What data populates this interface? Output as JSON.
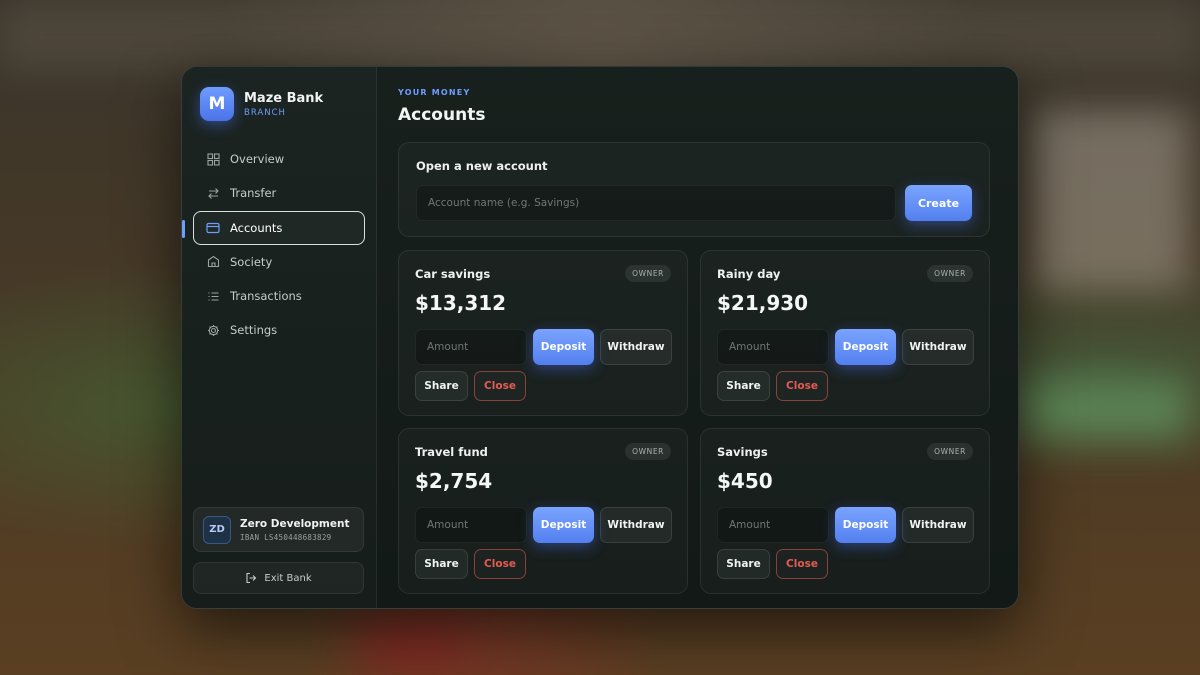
{
  "sidebar": {
    "brand": {
      "logo_letter": "M",
      "name": "Maze Bank",
      "subtitle": "BRANCH"
    },
    "nav": [
      {
        "label": "Overview",
        "icon": "grid-icon",
        "active": false
      },
      {
        "label": "Transfer",
        "icon": "transfer-arrows-icon",
        "active": false
      },
      {
        "label": "Accounts",
        "icon": "card-icon",
        "active": true
      },
      {
        "label": "Society",
        "icon": "bank-building-icon",
        "active": false
      },
      {
        "label": "Transactions",
        "icon": "list-icon",
        "active": false
      },
      {
        "label": "Settings",
        "icon": "gear-icon",
        "active": false
      }
    ],
    "profile": {
      "initials": "ZD",
      "name": "Zero Development",
      "iban": "IBAN LS450448683829"
    },
    "exit_label": "Exit Bank"
  },
  "main": {
    "eyebrow": "YOUR MONEY",
    "title": "Accounts",
    "open_account": {
      "title": "Open a new account",
      "input_placeholder": "Account name (e.g. Savings)",
      "input_value": "",
      "create_label": "Create"
    },
    "accounts": [
      {
        "name": "Car savings",
        "badge": "OWNER",
        "balance": "$13,312",
        "amount_placeholder": "Amount",
        "deposit": "Deposit",
        "withdraw": "Withdraw",
        "share": "Share",
        "close": "Close"
      },
      {
        "name": "Rainy day",
        "badge": "OWNER",
        "balance": "$21,930",
        "amount_placeholder": "Amount",
        "deposit": "Deposit",
        "withdraw": "Withdraw",
        "share": "Share",
        "close": "Close"
      },
      {
        "name": "Travel fund",
        "badge": "OWNER",
        "balance": "$2,754",
        "amount_placeholder": "Amount",
        "deposit": "Deposit",
        "withdraw": "Withdraw",
        "share": "Share",
        "close": "Close"
      },
      {
        "name": "Savings",
        "badge": "OWNER",
        "balance": "$450",
        "amount_placeholder": "Amount",
        "deposit": "Deposit",
        "withdraw": "Withdraw",
        "share": "Share",
        "close": "Close"
      }
    ]
  },
  "colors": {
    "accent": "#6f9cff",
    "danger": "#e45b52",
    "panel": "#141b19"
  }
}
